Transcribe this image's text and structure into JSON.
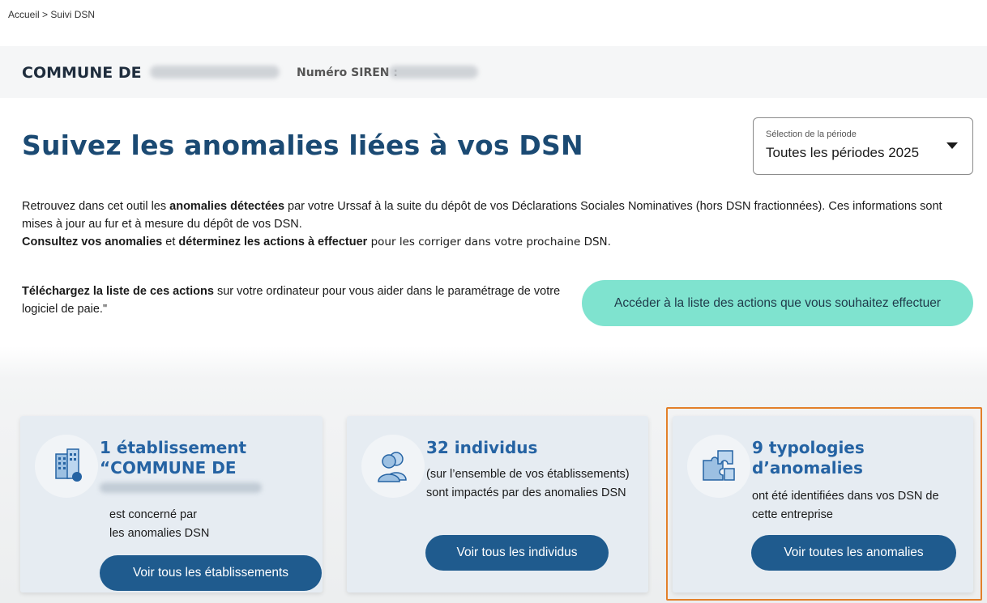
{
  "breadcrumb": {
    "home": "Accueil",
    "separator": ">",
    "current": "Suivi DSN"
  },
  "company": {
    "name_label": "COMMUNE DE",
    "siren_label": "Numéro SIREN :"
  },
  "header": {
    "title": "Suivez les anomalies liées à vos DSN",
    "period_label": "Sélection de la période",
    "period_value": "Toutes les périodes 2025"
  },
  "intro": {
    "p1_a": "Retrouvez dans cet outil les ",
    "p1_b": "anomalies détectées",
    "p1_c": " par votre Urssaf à la suite du dépôt de vos Déclarations Sociales Nominatives (hors DSN fractionnées). Ces informations sont mises à jour au fur et à mesure du dépôt de vos DSN.",
    "p2_a": "Consultez vos anomalies",
    "p2_b": " et ",
    "p2_c": "déterminez les actions à effectuer",
    "p2_d": " pour les corriger dans votre prochaine DSN."
  },
  "download": {
    "bold": "Téléchargez la liste de ces actions",
    "text": " sur votre ordinateur pour vous aider dans le paramétrage de votre logiciel de paie.\"",
    "button": "Accéder à la liste des actions que vous souhaitez effectuer"
  },
  "cards": [
    {
      "icon": "building-icon",
      "headline_1": "1 établissement",
      "headline_2": "“COMMUNE DE",
      "desc_1": "est concerné par",
      "desc_2": "les anomalies DSN",
      "button": "Voir tous les établissements"
    },
    {
      "icon": "people-icon",
      "headline_1": "32 individus",
      "desc": "(sur l’ensemble de vos établissements) sont impactés par des anomalies DSN",
      "button": "Voir tous les individus"
    },
    {
      "icon": "puzzle-icon",
      "headline_1": "9 typologies",
      "headline_2": "d’anomalies",
      "desc": "ont été identifiées dans vos DSN de cette entreprise",
      "button": "Voir toutes les anomalies"
    }
  ],
  "colors": {
    "title": "#1b4a73",
    "accent_button": "#7fe3cf",
    "primary_button": "#1f5b8e",
    "card_bg": "#e6ecf2",
    "highlight": "#e3802a"
  }
}
